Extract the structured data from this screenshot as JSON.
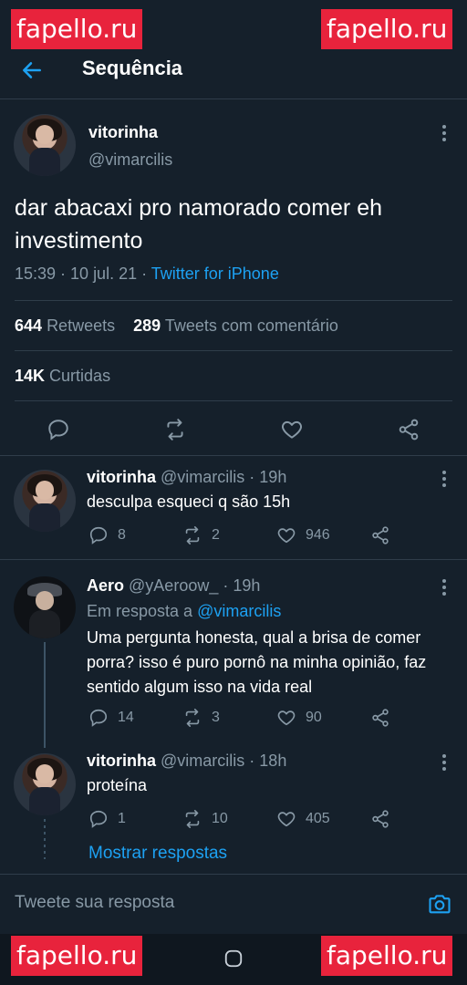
{
  "watermarks": [
    "fapello.ru",
    "fapello.ru",
    "fapello.ru",
    "fapello.ru"
  ],
  "header": {
    "title": "Sequência",
    "back_icon": "arrow-left-icon"
  },
  "main_tweet": {
    "name": "vitorinha",
    "handle": "@vimarcilis",
    "text": "dar abacaxi pro namorado comer eh investimento",
    "time": "15:39 · 10 jul. 21 · ",
    "source": "Twitter for iPhone",
    "retweets_count": "644",
    "retweets_label": "Retweets",
    "comments_count": "289",
    "comments_label": "Tweets com comentário",
    "likes_count": "14K",
    "likes_label": "Curtidas"
  },
  "replies": [
    {
      "name": "vitorinha",
      "meta": "@vimarcilis · 19h",
      "reply_prefix": "",
      "reply_to": "",
      "text": "desculpa esqueci q são 15h",
      "replies": "8",
      "retweets": "2",
      "likes": "946"
    },
    {
      "name": "Aero",
      "meta": "@yAeroow_ · 19h",
      "reply_prefix": "Em resposta a ",
      "reply_to": "@vimarcilis",
      "text": "Uma pergunta honesta, qual a brisa de comer porra? isso é puro pornô na minha opinião, faz sentido algum isso na vida real",
      "replies": "14",
      "retweets": "3",
      "likes": "90"
    },
    {
      "name": "vitorinha",
      "meta": "@vimarcilis · 18h",
      "reply_prefix": "",
      "reply_to": "",
      "text": "proteína",
      "replies": "1",
      "retweets": "10",
      "likes": "405"
    }
  ],
  "show_more": "Mostrar respostas",
  "compose": {
    "placeholder": "Tweete sua resposta",
    "icon": "camera-icon"
  },
  "colors": {
    "background": "#15202b",
    "accent": "#1da1f2",
    "muted": "#8899a6",
    "watermark": "#e8233c"
  }
}
